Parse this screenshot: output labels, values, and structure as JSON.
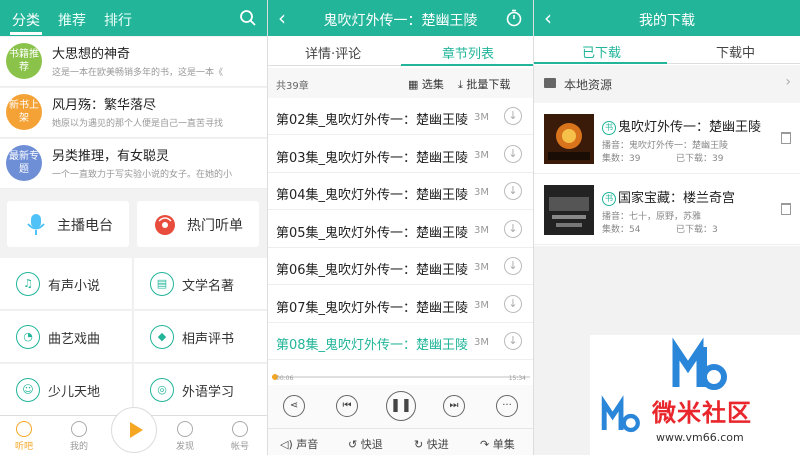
{
  "panel1": {
    "tabs": [
      "分类",
      "推荐",
      "排行"
    ],
    "recommendations": [
      {
        "badge": "书籍推荐",
        "title": "大思想的神奇",
        "desc": "这是一本在欧美畅销多年的书，这是一本《",
        "color": "#8bc34a"
      },
      {
        "badge": "新书上架",
        "title": "风月殇：繁华落尽",
        "desc": "她原以为遇见的那个人便是自己一直苦寻找",
        "color": "#f4a236"
      },
      {
        "badge": "最新专题",
        "title": "另类推理，有女聪灵",
        "desc": "一个一直致力于写实验小说的女子。在她的小",
        "color": "#6e8ed6"
      }
    ],
    "big_buttons": [
      "主播电台",
      "热门听单"
    ],
    "categories": [
      "有声小说",
      "文学名著",
      "曲艺戏曲",
      "相声评书",
      "少儿天地",
      "外语学习"
    ],
    "nav": [
      "听吧",
      "我的",
      "发现",
      "帐号"
    ]
  },
  "panel2": {
    "title": "鬼吹灯外传一：楚幽王陵",
    "tabs": [
      "详情·评论",
      "章节列表"
    ],
    "count": "共39章",
    "select_label": "选集",
    "batch_label": "批量下载",
    "chapters": [
      {
        "name": "第02集_鬼吹灯外传一：楚幽王陵",
        "size": "3M"
      },
      {
        "name": "第03集_鬼吹灯外传一：楚幽王陵",
        "size": "3M"
      },
      {
        "name": "第04集_鬼吹灯外传一：楚幽王陵",
        "size": "3M"
      },
      {
        "name": "第05集_鬼吹灯外传一：楚幽王陵",
        "size": "3M"
      },
      {
        "name": "第06集_鬼吹灯外传一：楚幽王陵",
        "size": "3M"
      },
      {
        "name": "第07集_鬼吹灯外传一：楚幽王陵",
        "size": "3M"
      },
      {
        "name": "第08集_鬼吹灯外传一：楚幽王陵",
        "size": "3M"
      }
    ],
    "time_current": "00:06",
    "time_total": "15:34",
    "progress": 0.01,
    "toolbar": [
      "声音",
      "快退",
      "快进",
      "单集"
    ]
  },
  "panel3": {
    "title": "我的下载",
    "tabs": [
      "已下载",
      "下载中"
    ],
    "local_label": "本地资源",
    "items": [
      {
        "title": "鬼吹灯外传一：楚幽王陵",
        "host": "播音：鬼吹灯外传一：楚幽王陵",
        "episodes": "集数：39",
        "downloaded": "已下载：39"
      },
      {
        "title": "国家宝藏：楼兰奇宫",
        "host": "播音：七十，原野，苏雅",
        "episodes": "集数：54",
        "downloaded": "已下载：3"
      }
    ]
  },
  "watermark": {
    "brand": "微米社区",
    "url": "www.vm66.com"
  },
  "colors": {
    "accent": "#22b59a",
    "playback": "#f5a623"
  }
}
